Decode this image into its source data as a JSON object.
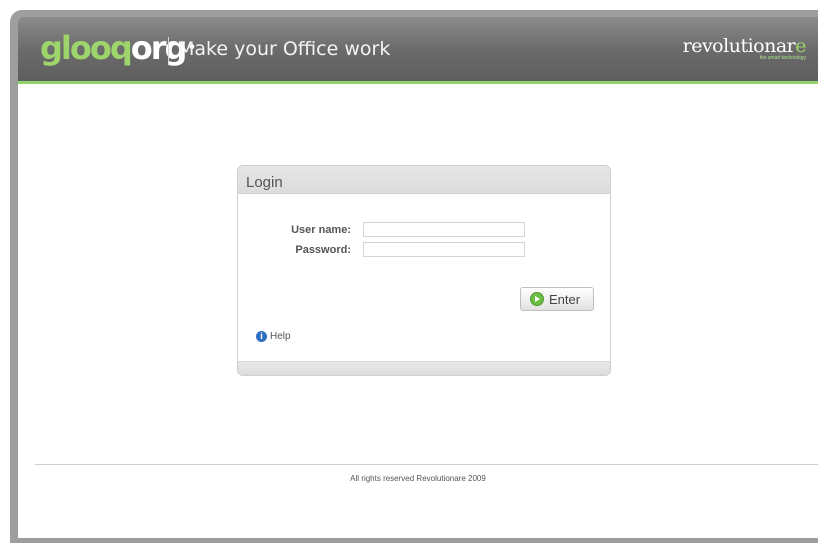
{
  "header": {
    "logo_part1": "glooq",
    "logo_part2": "org",
    "logo_dot": "•",
    "tagline": "Make your Office work",
    "brand_name": "revolutionar",
    "brand_name_accent": "e",
    "brand_sub": "the smart technology"
  },
  "login": {
    "title": "Login",
    "username_label": "User name:",
    "username_value": "",
    "password_label": "Password:",
    "password_value": "",
    "enter_label": "Enter",
    "help_icon": "i",
    "help_label": "Help"
  },
  "footer": {
    "text": "All rights reserved Revolutionare 2009"
  },
  "colors": {
    "accent": "#8fd46c",
    "header": "#6b6b6b"
  },
  "icons": {
    "enter": "arrow-right-circle-icon",
    "help": "info-icon"
  }
}
